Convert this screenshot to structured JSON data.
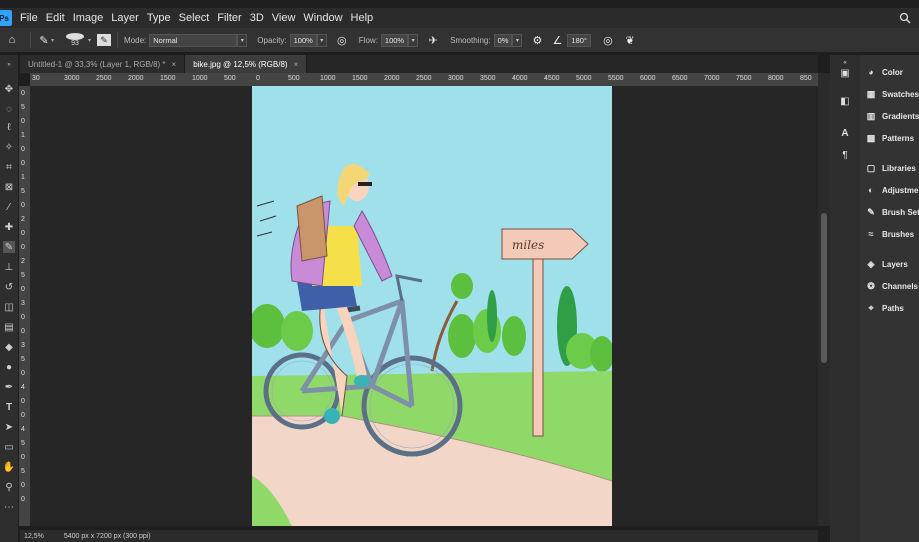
{
  "app": {
    "logo": "Ps"
  },
  "menu": [
    "File",
    "Edit",
    "Image",
    "Layer",
    "Type",
    "Select",
    "Filter",
    "3D",
    "View",
    "Window",
    "Help"
  ],
  "options": {
    "brush_size": "93",
    "mode_label": "Mode:",
    "mode_value": "Normal",
    "opacity_label": "Opacity:",
    "opacity_value": "100%",
    "flow_label": "Flow:",
    "flow_value": "100%",
    "smoothing_label": "Smoothing:",
    "smoothing_value": "0%",
    "angle_value": "180°"
  },
  "tabs": [
    {
      "label": "Untitled-1 @ 33,3% (Layer 1, RGB/8) *",
      "active": false
    },
    {
      "label": "bike.jpg @ 12,5% (RGB/8)",
      "active": true
    }
  ],
  "ruler_h": [
    "30",
    "3000",
    "2500",
    "2000",
    "1500",
    "1000",
    "500",
    "0",
    "500",
    "1000",
    "1500",
    "2000",
    "2500",
    "3000",
    "3500",
    "4000",
    "4500",
    "5000",
    "5500",
    "6000",
    "6500",
    "7000",
    "7500",
    "8000",
    "850"
  ],
  "ruler_v": [
    "0",
    "5",
    "0",
    "1",
    "0",
    "0",
    "1",
    "5",
    "0",
    "2",
    "0",
    "0",
    "2",
    "5",
    "0",
    "3",
    "0",
    "0",
    "3",
    "5",
    "0",
    "4",
    "0",
    "0",
    "4",
    "5",
    "0",
    "5",
    "0",
    "0"
  ],
  "panels": [
    "Color",
    "Swatches",
    "Gradients",
    "Patterns",
    "Libraries",
    "Adjustments",
    "Brush Settings",
    "Brushes",
    "Layers",
    "Channels",
    "Paths"
  ],
  "artwork": {
    "sign_text": "miles"
  },
  "status": {
    "zoom": "12,5%",
    "doc_size": "5400 px x 7200 px (300 ppi)"
  },
  "colors": {
    "sky": "#9fe0ea",
    "grass": "#8fd968",
    "path": "#f2d7c8",
    "bike": "#7d90a8",
    "jacket": "#c98bd8",
    "accent": "#2fa3f7"
  }
}
